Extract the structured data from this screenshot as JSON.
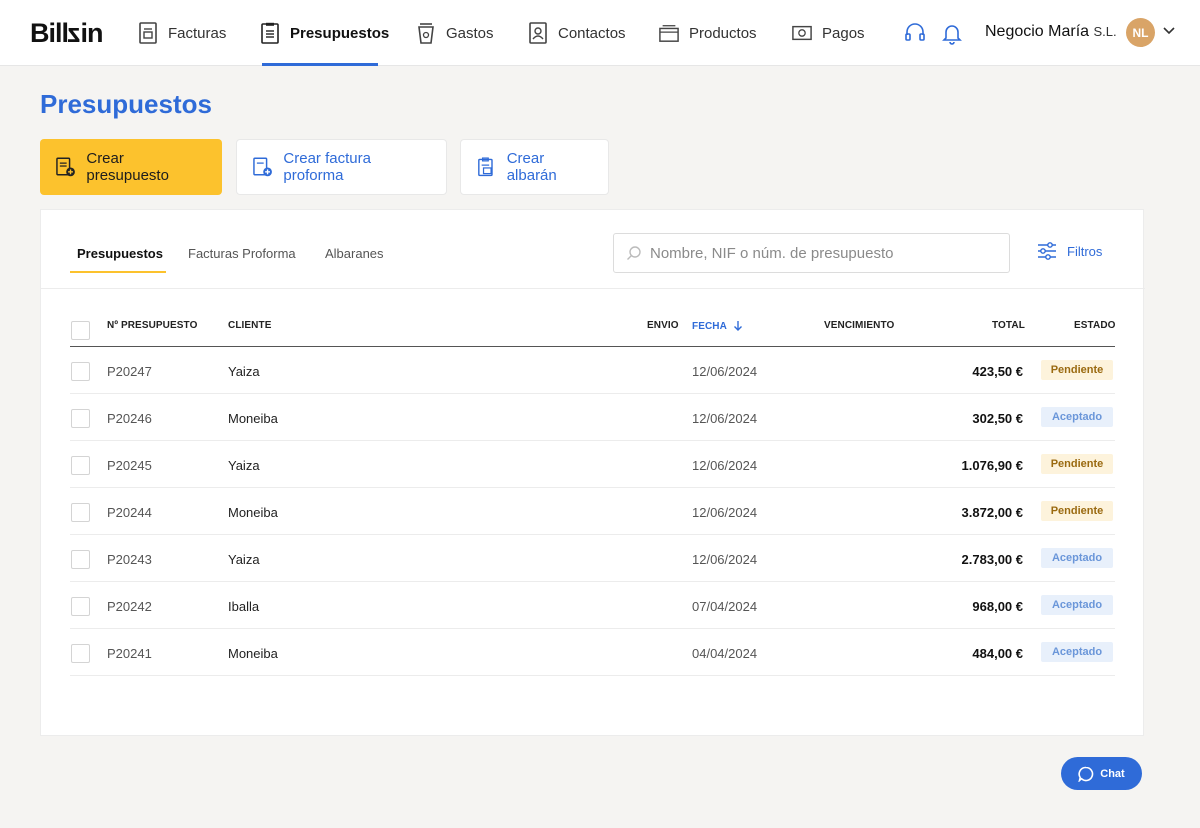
{
  "brand": {
    "logo_text": "Billin"
  },
  "nav": {
    "items": [
      {
        "label": "Facturas",
        "icon": "invoice-icon"
      },
      {
        "label": "Presupuestos",
        "icon": "budget-icon",
        "active": true
      },
      {
        "label": "Gastos",
        "icon": "cup-icon"
      },
      {
        "label": "Contactos",
        "icon": "contacts-icon"
      },
      {
        "label": "Productos",
        "icon": "box-icon"
      },
      {
        "label": "Pagos",
        "icon": "money-icon"
      }
    ]
  },
  "header": {
    "company_name": "Negocio María",
    "company_suffix": "S.L.",
    "avatar_initials": "NL"
  },
  "page": {
    "title": "Presupuestos",
    "actions": {
      "create_budget": "Crear presupuesto",
      "create_proforma": "Crear factura proforma",
      "create_delivery": "Crear albarán"
    }
  },
  "panel": {
    "tabs": [
      "Presupuestos",
      "Facturas Proforma",
      "Albaranes"
    ],
    "active_tab": "Presupuestos",
    "search_placeholder": "Nombre, NIF o núm. de presupuesto",
    "filters_label": "Filtros"
  },
  "table": {
    "columns": {
      "number": "Nº PRESUPUESTO",
      "client": "CLIENTE",
      "envio": "ENVIO",
      "fecha": "FECHA",
      "vencimiento": "VENCIMIENTO",
      "total": "TOTAL",
      "estado": "ESTADO"
    },
    "rows": [
      {
        "number": "P20247",
        "client": "Yaiza",
        "date": "12/06/2024",
        "total": "423,50 €",
        "status": "Pendiente"
      },
      {
        "number": "P20246",
        "client": "Moneiba",
        "date": "12/06/2024",
        "total": "302,50 €",
        "status": "Aceptado"
      },
      {
        "number": "P20245",
        "client": "Yaiza",
        "date": "12/06/2024",
        "total": "1.076,90 €",
        "status": "Pendiente"
      },
      {
        "number": "P20244",
        "client": "Moneiba",
        "date": "12/06/2024",
        "total": "3.872,00 €",
        "status": "Pendiente"
      },
      {
        "number": "P20243",
        "client": "Yaiza",
        "date": "12/06/2024",
        "total": "2.783,00 €",
        "status": "Aceptado"
      },
      {
        "number": "P20242",
        "client": "Iballa",
        "date": "07/04/2024",
        "total": "968,00 €",
        "status": "Aceptado"
      },
      {
        "number": "P20241",
        "client": "Moneiba",
        "date": "04/04/2024",
        "total": "484,00 €",
        "status": "Aceptado"
      }
    ]
  },
  "chat": {
    "label": "Chat"
  },
  "colors": {
    "accent": "#2f6bd8",
    "primary_button": "#fcc22d",
    "pending": "#9a6a10",
    "accepted": "#6a96d9"
  }
}
